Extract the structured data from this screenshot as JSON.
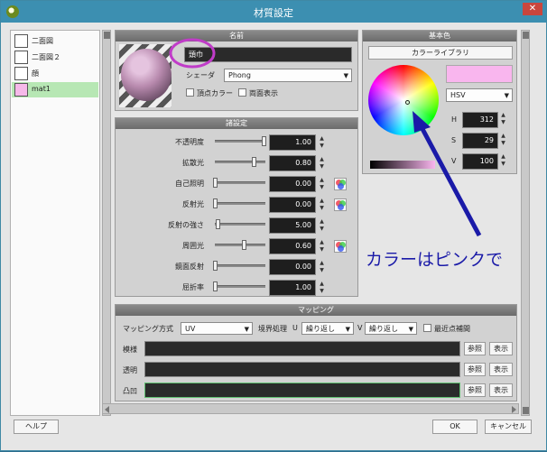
{
  "window": {
    "title": "材質設定",
    "close_glyph": "✕"
  },
  "materials": [
    {
      "label": "二面図",
      "color": "#ffffff",
      "selected": false
    },
    {
      "label": "二面図２",
      "color": "#ffffff",
      "selected": false
    },
    {
      "label": "顔",
      "color": "#ffffff",
      "selected": false
    },
    {
      "label": "mat1",
      "color": "#f6b9e9",
      "selected": true
    }
  ],
  "name_panel": {
    "header": "名前",
    "name_value": "頭巾",
    "shader_label": "シェーダ",
    "shader_value": "Phong",
    "vertex_color_label": "頂点カラー",
    "double_sided_label": "両面表示"
  },
  "settings_panel": {
    "header": "諸設定",
    "rows": [
      {
        "label": "不透明度",
        "value": "1.00",
        "level": 1.0,
        "texture": false
      },
      {
        "label": "拡散光",
        "value": "0.80",
        "level": 0.8,
        "texture": false
      },
      {
        "label": "自己照明",
        "value": "0.00",
        "level": 0.0,
        "texture": true
      },
      {
        "label": "反射光",
        "value": "0.00",
        "level": 0.0,
        "texture": true
      },
      {
        "label": "反射の強さ",
        "value": "5.00",
        "level": 0.05,
        "texture": false
      },
      {
        "label": "周囲光",
        "value": "0.60",
        "level": 0.6,
        "texture": true
      },
      {
        "label": "鏡面反射",
        "value": "0.00",
        "level": 0.0,
        "texture": false
      },
      {
        "label": "屈折率",
        "value": "1.00",
        "level": 0.0,
        "texture": false
      }
    ]
  },
  "base_color_panel": {
    "header": "基本色",
    "library_button": "カラーライブラリ",
    "swatch_color": "#f9b6ee",
    "mode_value": "HSV",
    "channels": [
      {
        "label": "H",
        "value": "312"
      },
      {
        "label": "S",
        "value": "29"
      },
      {
        "label": "V",
        "value": "100"
      }
    ]
  },
  "mapping_panel": {
    "header": "マッピング",
    "method_label": "マッピング方式",
    "method_value": "UV",
    "border_label": "境界処理",
    "u_label": "U",
    "u_value": "繰り返し",
    "v_label": "V",
    "v_value": "繰り返し",
    "nearest_label": "最近点補間",
    "rows": [
      {
        "label": "模様",
        "browse": "参照",
        "show": "表示"
      },
      {
        "label": "透明",
        "browse": "参照",
        "show": "表示"
      },
      {
        "label": "凸凹",
        "browse": "参照",
        "show": "表示"
      }
    ]
  },
  "footer": {
    "help": "ヘルプ",
    "ok": "OK",
    "cancel": "キャンセル"
  },
  "annotation": {
    "text": "カラーはピンクで"
  },
  "colors": {
    "title_bar": "#3c8fb1",
    "selection": "#b7e7b4",
    "annot": "#1a1aa8",
    "highlight_circle": "#c03cc8"
  }
}
